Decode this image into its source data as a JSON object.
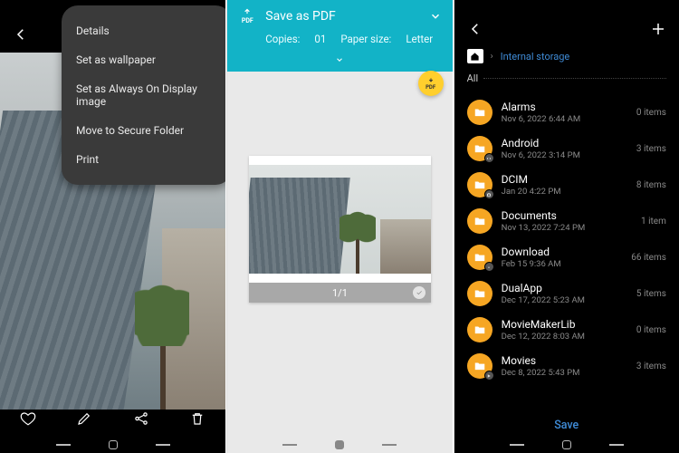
{
  "panel1": {
    "menu": {
      "items": [
        "Details",
        "Set as wallpaper",
        "Set as Always On Display image",
        "Move to Secure Folder",
        "Print"
      ]
    }
  },
  "panel2": {
    "title": "Save as PDF",
    "copies_label": "Copies:",
    "copies_value": "01",
    "papersize_label": "Paper size:",
    "papersize_value": "Letter",
    "pdf_badge": "PDF",
    "page_indicator": "1/1"
  },
  "panel3": {
    "breadcrumb": "Internal storage",
    "all_label": "All",
    "save_label": "Save",
    "folders": [
      {
        "name": "Alarms",
        "date": "Nov 6, 2022 6:44 AM",
        "count": "0 items",
        "badge": null
      },
      {
        "name": "Android",
        "date": "Nov 6, 2022 3:14 PM",
        "count": "3 items",
        "badge": "gear"
      },
      {
        "name": "DCIM",
        "date": "Jan 20 4:22 PM",
        "count": "8 items",
        "badge": "camera"
      },
      {
        "name": "Documents",
        "date": "Nov 13, 2022 7:24 PM",
        "count": "1 item",
        "badge": null
      },
      {
        "name": "Download",
        "date": "Feb 15 9:36 AM",
        "count": "66 items",
        "badge": "down"
      },
      {
        "name": "DualApp",
        "date": "Dec 17, 2022 5:23 AM",
        "count": "5 items",
        "badge": null
      },
      {
        "name": "MovieMakerLib",
        "date": "Dec 12, 2022 8:03 AM",
        "count": "0 items",
        "badge": null
      },
      {
        "name": "Movies",
        "date": "Dec 8, 2022 5:43 PM",
        "count": "3 items",
        "badge": "play"
      }
    ]
  }
}
